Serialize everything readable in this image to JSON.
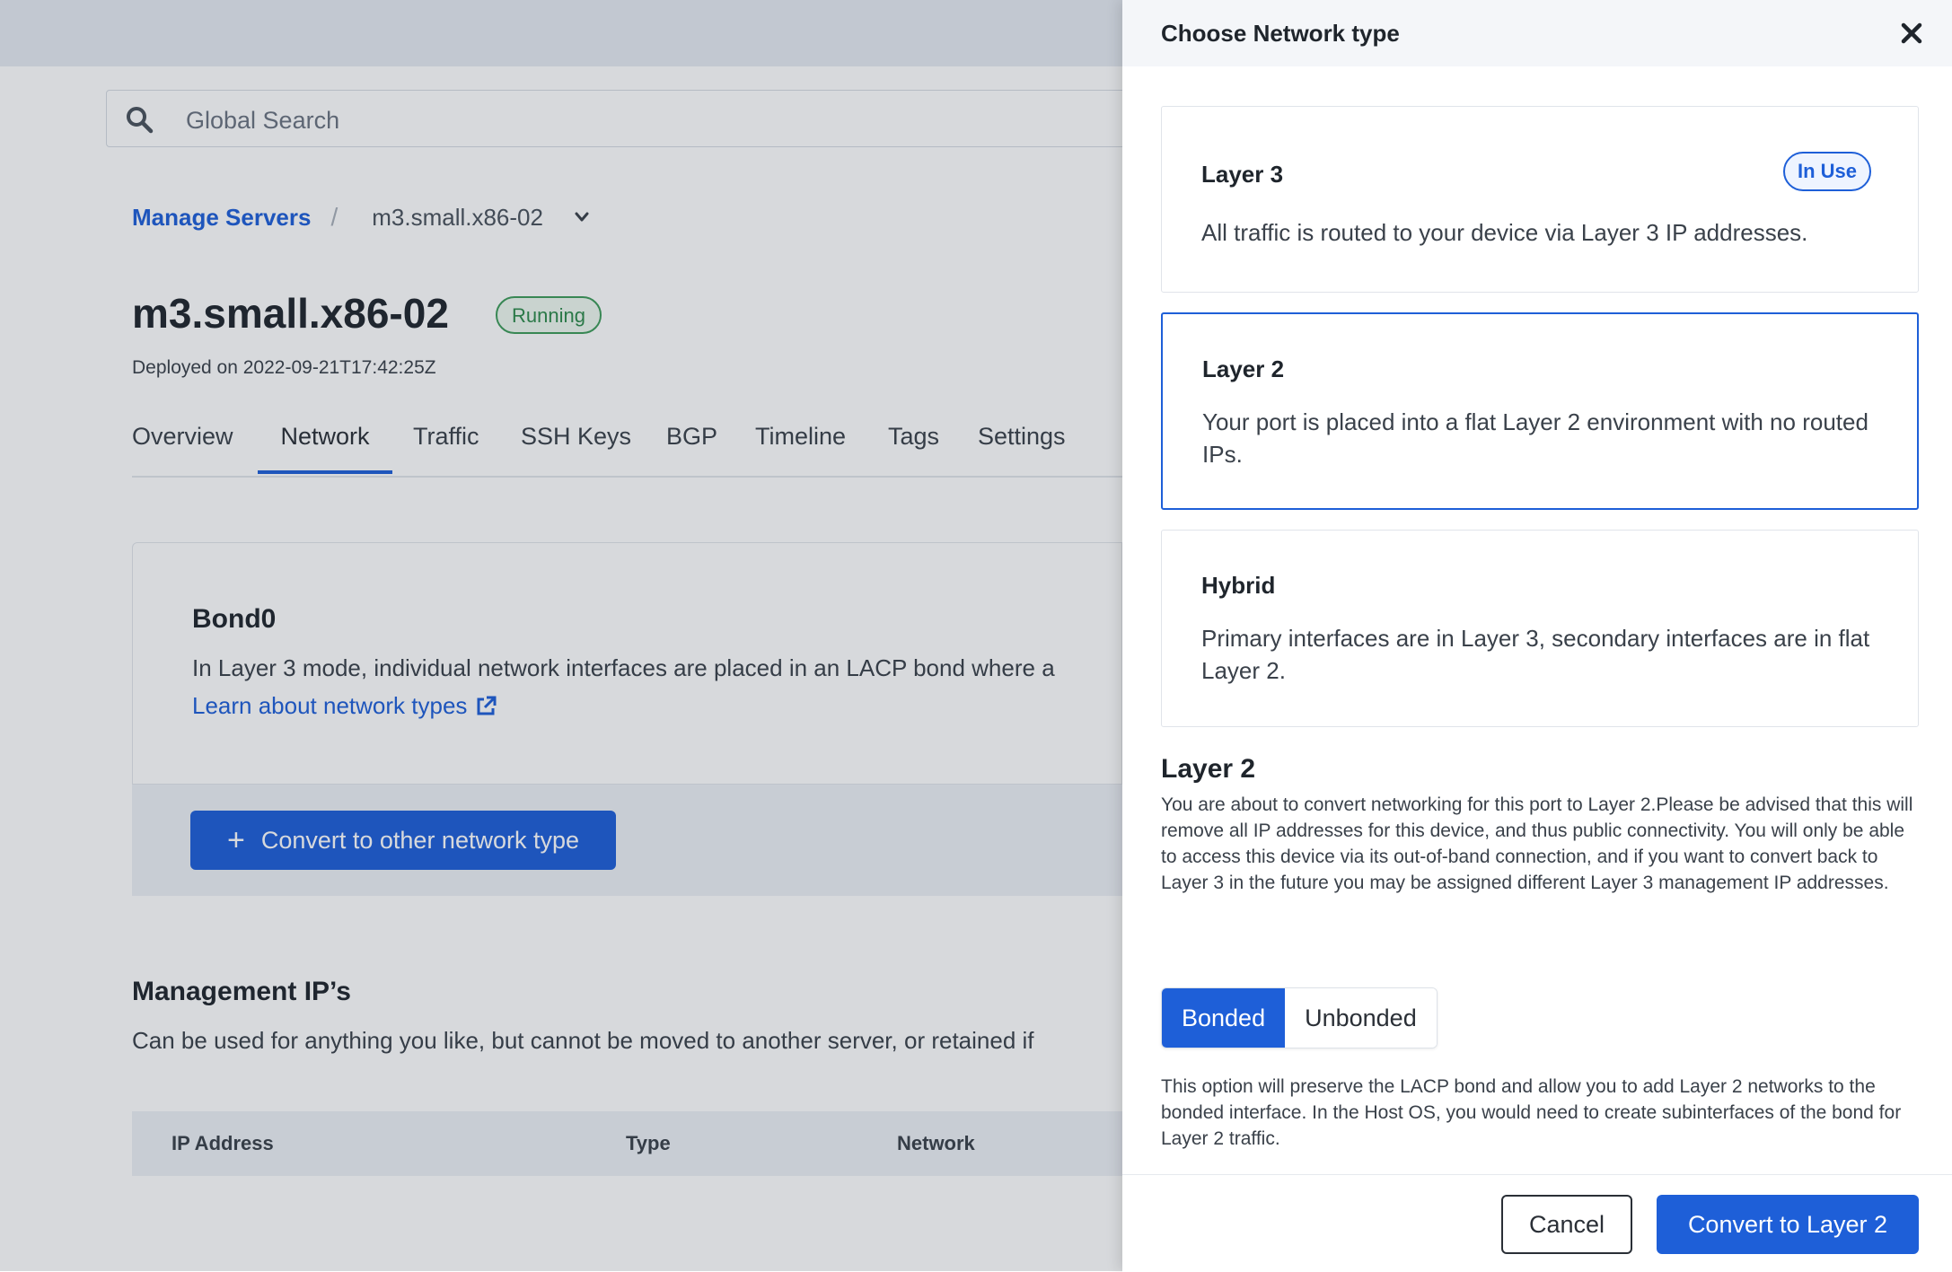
{
  "colors": {
    "accent": "#1e5fd8",
    "running": "#2e8a4b",
    "overlay": "#232d3c"
  },
  "search": {
    "placeholder": "Global Search",
    "icon": "search-icon"
  },
  "breadcrumb": {
    "parent": "Manage Servers",
    "separator": "/",
    "current": "m3.small.x86-02"
  },
  "server": {
    "name": "m3.small.x86-02",
    "status": "Running",
    "deployed": "Deployed on 2022-09-21T17:42:25Z"
  },
  "tabs": [
    "Overview",
    "Network",
    "Traffic",
    "SSH Keys",
    "BGP",
    "Timeline",
    "Tags",
    "Settings"
  ],
  "active_tab": "Network",
  "bond": {
    "title": "Bond0",
    "description": "In Layer 3 mode, individual network interfaces are placed in an LACP bond where a",
    "link": "Learn about network types",
    "convert_button": "Convert to other network type"
  },
  "management": {
    "title": "Management IP’s",
    "description": "Can be used for anything you like, but cannot be moved to another server, or retained if",
    "columns": [
      "IP Address",
      "Type",
      "Network"
    ]
  },
  "drawer": {
    "title": "Choose Network type",
    "options": [
      {
        "title": "Layer 3",
        "description": "All traffic is routed to your device via Layer 3 IP addresses.",
        "badge": "In Use"
      },
      {
        "title": "Layer 2",
        "description": "Your port is placed into a flat Layer 2 environment with no routed IPs."
      },
      {
        "title": "Hybrid",
        "description": "Primary interfaces are in Layer 3, secondary interfaces are in flat Layer 2."
      }
    ],
    "selected_option": "Layer 2",
    "info_title": "Layer 2",
    "info_text": "You are about to convert networking for this port to Layer 2.Please be advised that this will remove all IP addresses for this device, and thus public connectivity. You will only be able to access this device via its out-of-band connection, and if you want to convert back to Layer 3 in the future you may be assigned different Layer 3 management IP addresses.",
    "segments": [
      "Bonded",
      "Unbonded"
    ],
    "active_segment": "Bonded",
    "segment_description": "This option will preserve the LACP bond and allow you to add Layer 2 networks to the bonded interface. In the Host OS, you would need to create subinterfaces of the bond for Layer 2 traffic.",
    "cancel": "Cancel",
    "submit": "Convert to Layer 2"
  }
}
